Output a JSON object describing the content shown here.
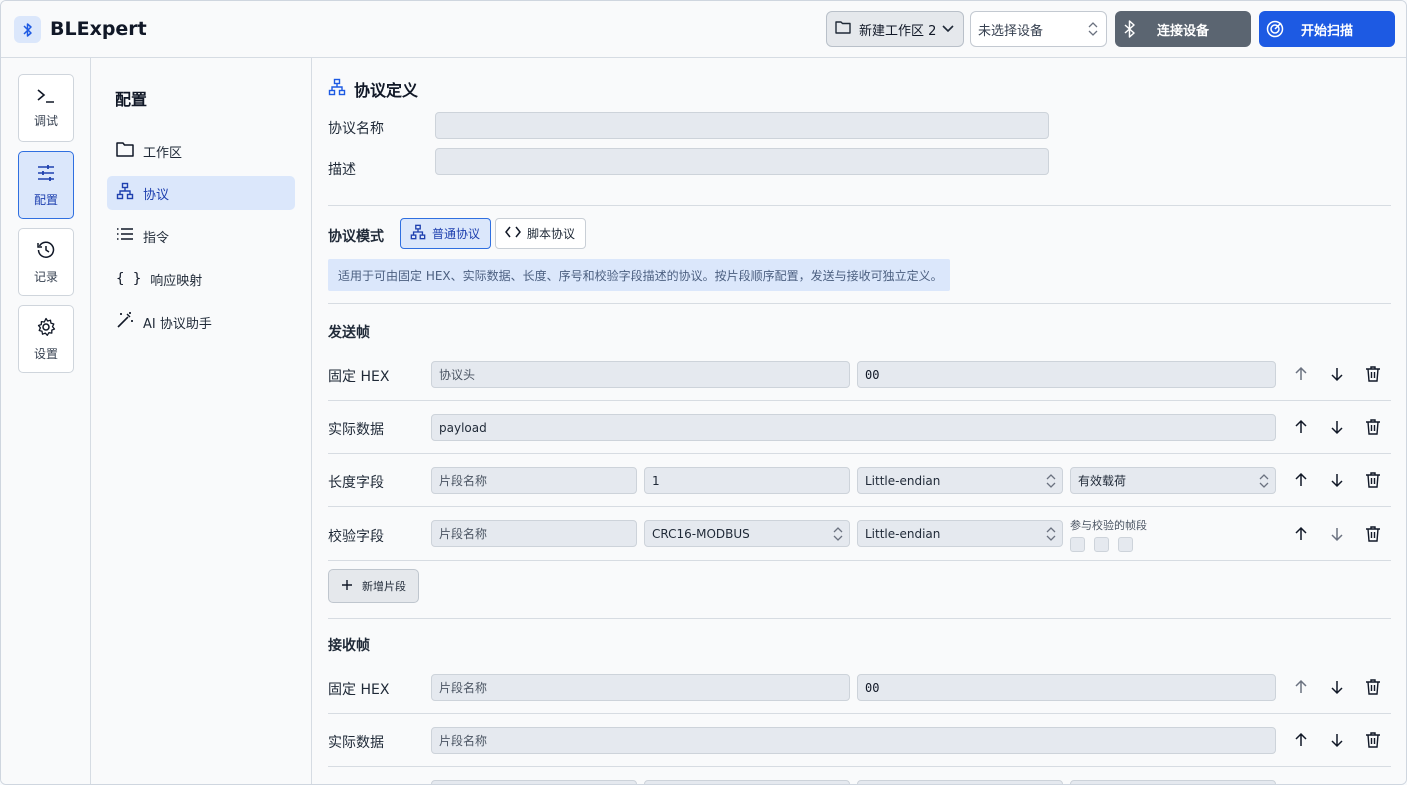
{
  "app": {
    "title": "BLExpert"
  },
  "topbar": {
    "workspace": "新建工作区 2",
    "device_select": "未选择设备",
    "connect_label": "连接设备",
    "scan_label": "开始扫描"
  },
  "rail": {
    "items": [
      {
        "label": "调试",
        "icon": "terminal-icon"
      },
      {
        "label": "配置",
        "icon": "sliders-icon",
        "active": true
      },
      {
        "label": "记录",
        "icon": "history-icon"
      },
      {
        "label": "设置",
        "icon": "gear-icon"
      }
    ]
  },
  "subnav": {
    "title": "配置",
    "items": [
      {
        "label": "工作区",
        "icon": "folder-icon"
      },
      {
        "label": "协议",
        "icon": "network-icon",
        "active": true
      },
      {
        "label": "指令",
        "icon": "list-icon"
      },
      {
        "label": "响应映射",
        "icon": "braces-icon"
      },
      {
        "label": "AI 协议助手",
        "icon": "magic-wand-icon"
      }
    ]
  },
  "protocol": {
    "section_title": "协议定义",
    "name_label": "协议名称",
    "name_value": "",
    "desc_label": "描述",
    "desc_value": "",
    "mode_label": "协议模式",
    "mode_normal": "普通协议",
    "mode_script": "脚本协议",
    "mode_info": "适用于可由固定 HEX、实际数据、长度、序号和校验字段描述的协议。按片段顺序配置，发送与接收可独立定义。"
  },
  "send_frame": {
    "title": "发送帧",
    "rows": [
      {
        "label": "固定 HEX",
        "name_placeholder": "协议头",
        "hex": "00"
      },
      {
        "label": "实际数据",
        "value": "payload"
      },
      {
        "label": "长度字段",
        "name_placeholder": "片段名称",
        "length": "1",
        "endian": "Little-endian",
        "scope": "有效载荷"
      },
      {
        "label": "校验字段",
        "name_placeholder": "片段名称",
        "algo": "CRC16-MODBUS",
        "endian": "Little-endian",
        "caption": "参与校验的帧段"
      }
    ],
    "add_label": "新增片段"
  },
  "recv_frame": {
    "title": "接收帧",
    "rows": [
      {
        "label": "固定 HEX",
        "name_placeholder": "片段名称",
        "hex": "00"
      },
      {
        "label": "实际数据",
        "name_placeholder": "片段名称"
      }
    ]
  },
  "colors": {
    "accent": "#1d5ae3",
    "active_bg": "#dbe7fb",
    "connect_bg": "#5b6571"
  }
}
